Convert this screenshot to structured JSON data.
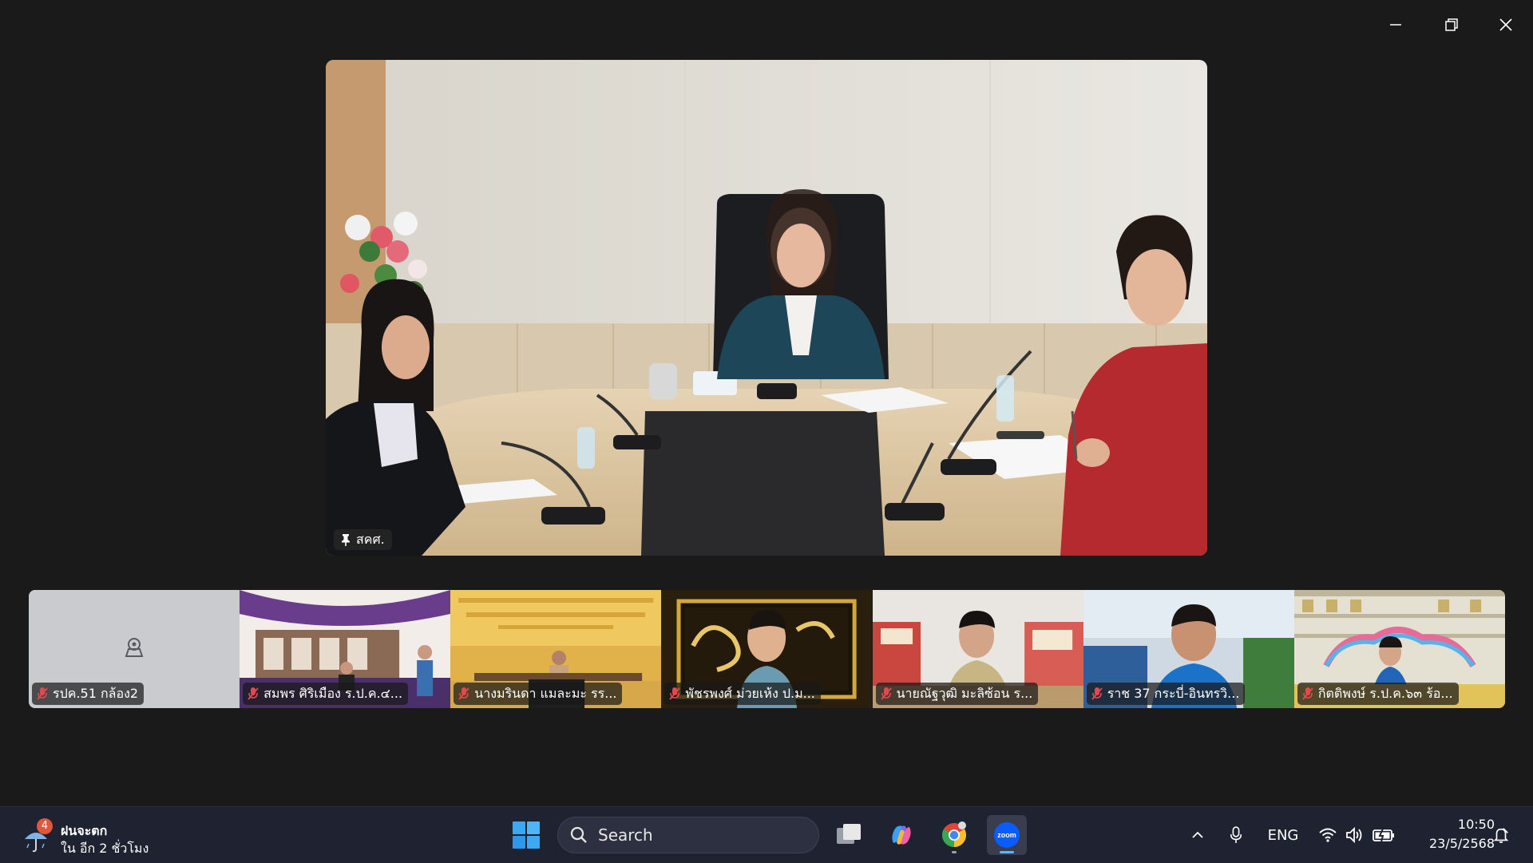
{
  "window": {
    "controls": [
      "minimize-icon",
      "restore-icon",
      "close-icon"
    ]
  },
  "main_video": {
    "label": "สคศ.",
    "pinned": true
  },
  "participants": [
    {
      "name": "รปค.51 กล้อง2",
      "muted": true,
      "video_on": false,
      "icon": "camera-off-icon"
    },
    {
      "name": "สมพร ศิริเมือง ร.ป.ค.๔...",
      "muted": true,
      "video_on": true
    },
    {
      "name": "นางมรินดา แมละมะ รร...",
      "muted": true,
      "video_on": true
    },
    {
      "name": "พัชรพงศ์ ม่วยเห้ง ป.ม...",
      "muted": true,
      "video_on": true
    },
    {
      "name": "นายณัฐวุฒิ มะลิซ้อน ร...",
      "muted": true,
      "video_on": true
    },
    {
      "name": "ราช 37 กระบี่-อินทรวิ...",
      "muted": true,
      "video_on": true
    },
    {
      "name": "กิตติพงษ์ ร.ป.ค.๖๓ ร้อ...",
      "muted": true,
      "video_on": true
    }
  ],
  "taskbar": {
    "weather": {
      "badge": "4",
      "title": "ฝนจะตก",
      "subtitle": "ใน อีก 2 ชั่วโมง",
      "icon": "umbrella-rain-icon"
    },
    "search_label": "Search",
    "apps": [
      "start-icon",
      "task-view-icon",
      "copilot-icon",
      "chrome-icon",
      "zoom-icon"
    ],
    "active_app": "zoom-icon",
    "tray": {
      "language": "ENG",
      "time": "10:50",
      "date": "23/5/2568"
    }
  },
  "colors": {
    "background": "#1a1a1a",
    "taskbar": "#1f2230",
    "mute_red": "#e5484d",
    "zoom_blue": "#0b5cff"
  }
}
